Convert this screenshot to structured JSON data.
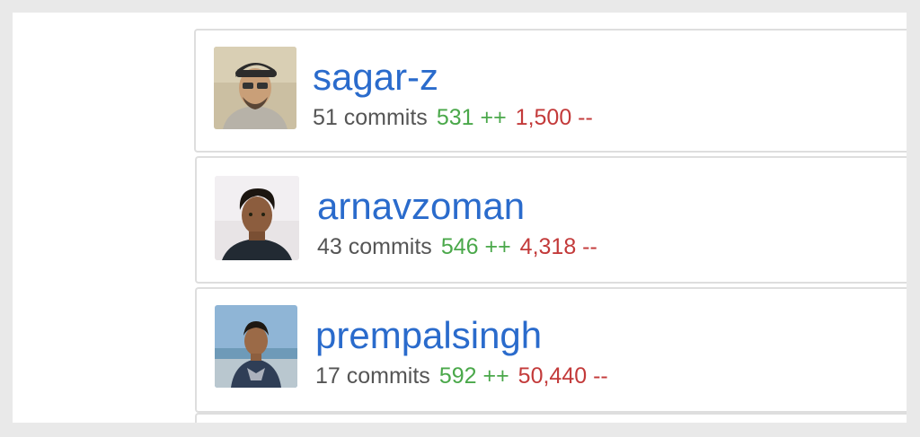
{
  "contributors": [
    {
      "username": "sagar-z",
      "commits": "51 commits",
      "additions": "531 ++",
      "deletions": "1,500 --",
      "avatar_icon": "avatar-photo-person-with-cap"
    },
    {
      "username": "arnavzoman",
      "commits": "43 commits",
      "additions": "546 ++",
      "deletions": "4,318 --",
      "avatar_icon": "avatar-photo-person-portrait"
    },
    {
      "username": "prempalsingh",
      "commits": "17 commits",
      "additions": "592 ++",
      "deletions": "50,440 --",
      "avatar_icon": "avatar-photo-person-outdoors"
    }
  ],
  "colors": {
    "username": "#2a6bcc",
    "commits": "#555555",
    "additions": "#4aa84a",
    "deletions": "#c33a3a",
    "card_border": "#dedede"
  }
}
